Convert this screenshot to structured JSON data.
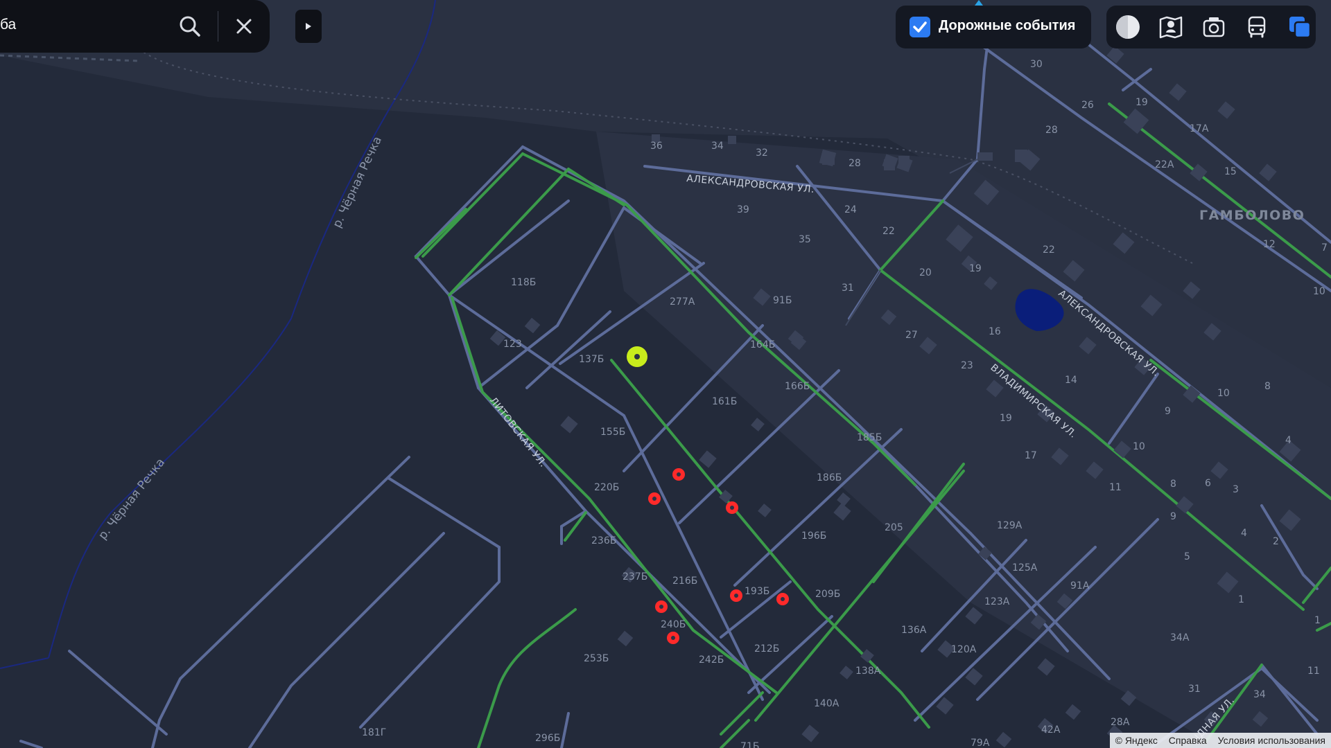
{
  "search": {
    "query": "ба"
  },
  "traffic": {
    "label": "Дорожные события",
    "checked": true
  },
  "layer_buttons": [
    "scheme-icon",
    "panorama-icon",
    "photo-icon",
    "transit-icon",
    "layers-icon"
  ],
  "streets": {
    "aleksandrovskaya_top": "АЛЕКСАНДРОВСКАЯ УЛ.",
    "aleksandrovskaya_diag": "АЛЕКСАНДРОВСКАЯ УЛ.",
    "vladimirskaya": "ВЛАДИМИРСКАЯ УЛ.",
    "litovskaya": "ЛИТОВСКАЯ УЛ.",
    "bottom_partial": "ЫДНАЯ УЛ."
  },
  "rivers": {
    "upper": "р. Чёрная Речка",
    "lower": "р. Чёрная Речка"
  },
  "place_name": "ГАМБОЛОВО",
  "house_numbers": {
    "n1": "36",
    "n2": "34",
    "n3": "32",
    "n4": "28",
    "n5": "39",
    "n6": "24",
    "n7": "22",
    "n8": "35",
    "n9": "31",
    "n10": "20",
    "n11": "19",
    "n12": "27",
    "n13": "16",
    "n14": "23",
    "n15": "14",
    "n16": "19",
    "n17": "17",
    "n18": "30",
    "n19": "26",
    "n20": "28",
    "n21": "19",
    "n22": "17А",
    "n23": "22А",
    "n24": "15",
    "n25": "22",
    "n26": "12",
    "n27": "10",
    "n28": "10",
    "n29": "8",
    "n30": "9",
    "n31": "4",
    "n32": "10",
    "n33": "8",
    "n34": "6",
    "n35": "3",
    "n36": "11",
    "n37": "9",
    "n38": "4",
    "n39": "2",
    "n40": "5",
    "n41": "1",
    "n42": "118Б",
    "n43": "277А",
    "n44": "91Б",
    "n45": "123",
    "n46": "137Б",
    "n47": "164Б",
    "n48": "166Б",
    "n49": "161Б",
    "n50": "155Б",
    "n51": "185Б",
    "n52": "220Б",
    "n53": "186Б",
    "n54": "196Б",
    "n55": "205",
    "n56": "236Б",
    "n57": "237Б",
    "n58": "216Б",
    "n59": "193Б",
    "n60": "209Б",
    "n61": "240Б",
    "n62": "212Б",
    "n63": "242Б",
    "n64": "253Б",
    "n65": "129А",
    "n66": "125А",
    "n67": "91А",
    "n68": "123А",
    "n69": "136А",
    "n70": "120А",
    "n71": "34А",
    "n72": "138А",
    "n73": "140А",
    "n74": "31",
    "n75": "34",
    "n76": "28А",
    "n77": "42А",
    "n78": "79А",
    "n79": "181Г",
    "n80": "296Б",
    "n81": "71Б",
    "n82": "11",
    "n83": "7",
    "n84": "1"
  },
  "user_location": {
    "color": "#c8ec1c"
  },
  "incidents": {
    "count": 7,
    "color": "#ff2a2a"
  },
  "colors": {
    "road": "#5d6c9a",
    "path": "#3b9b4a",
    "water": "#0a1e7a"
  },
  "copyright": {
    "brand": "© Яндекс",
    "help": "Справка",
    "terms": "Условия использования"
  }
}
